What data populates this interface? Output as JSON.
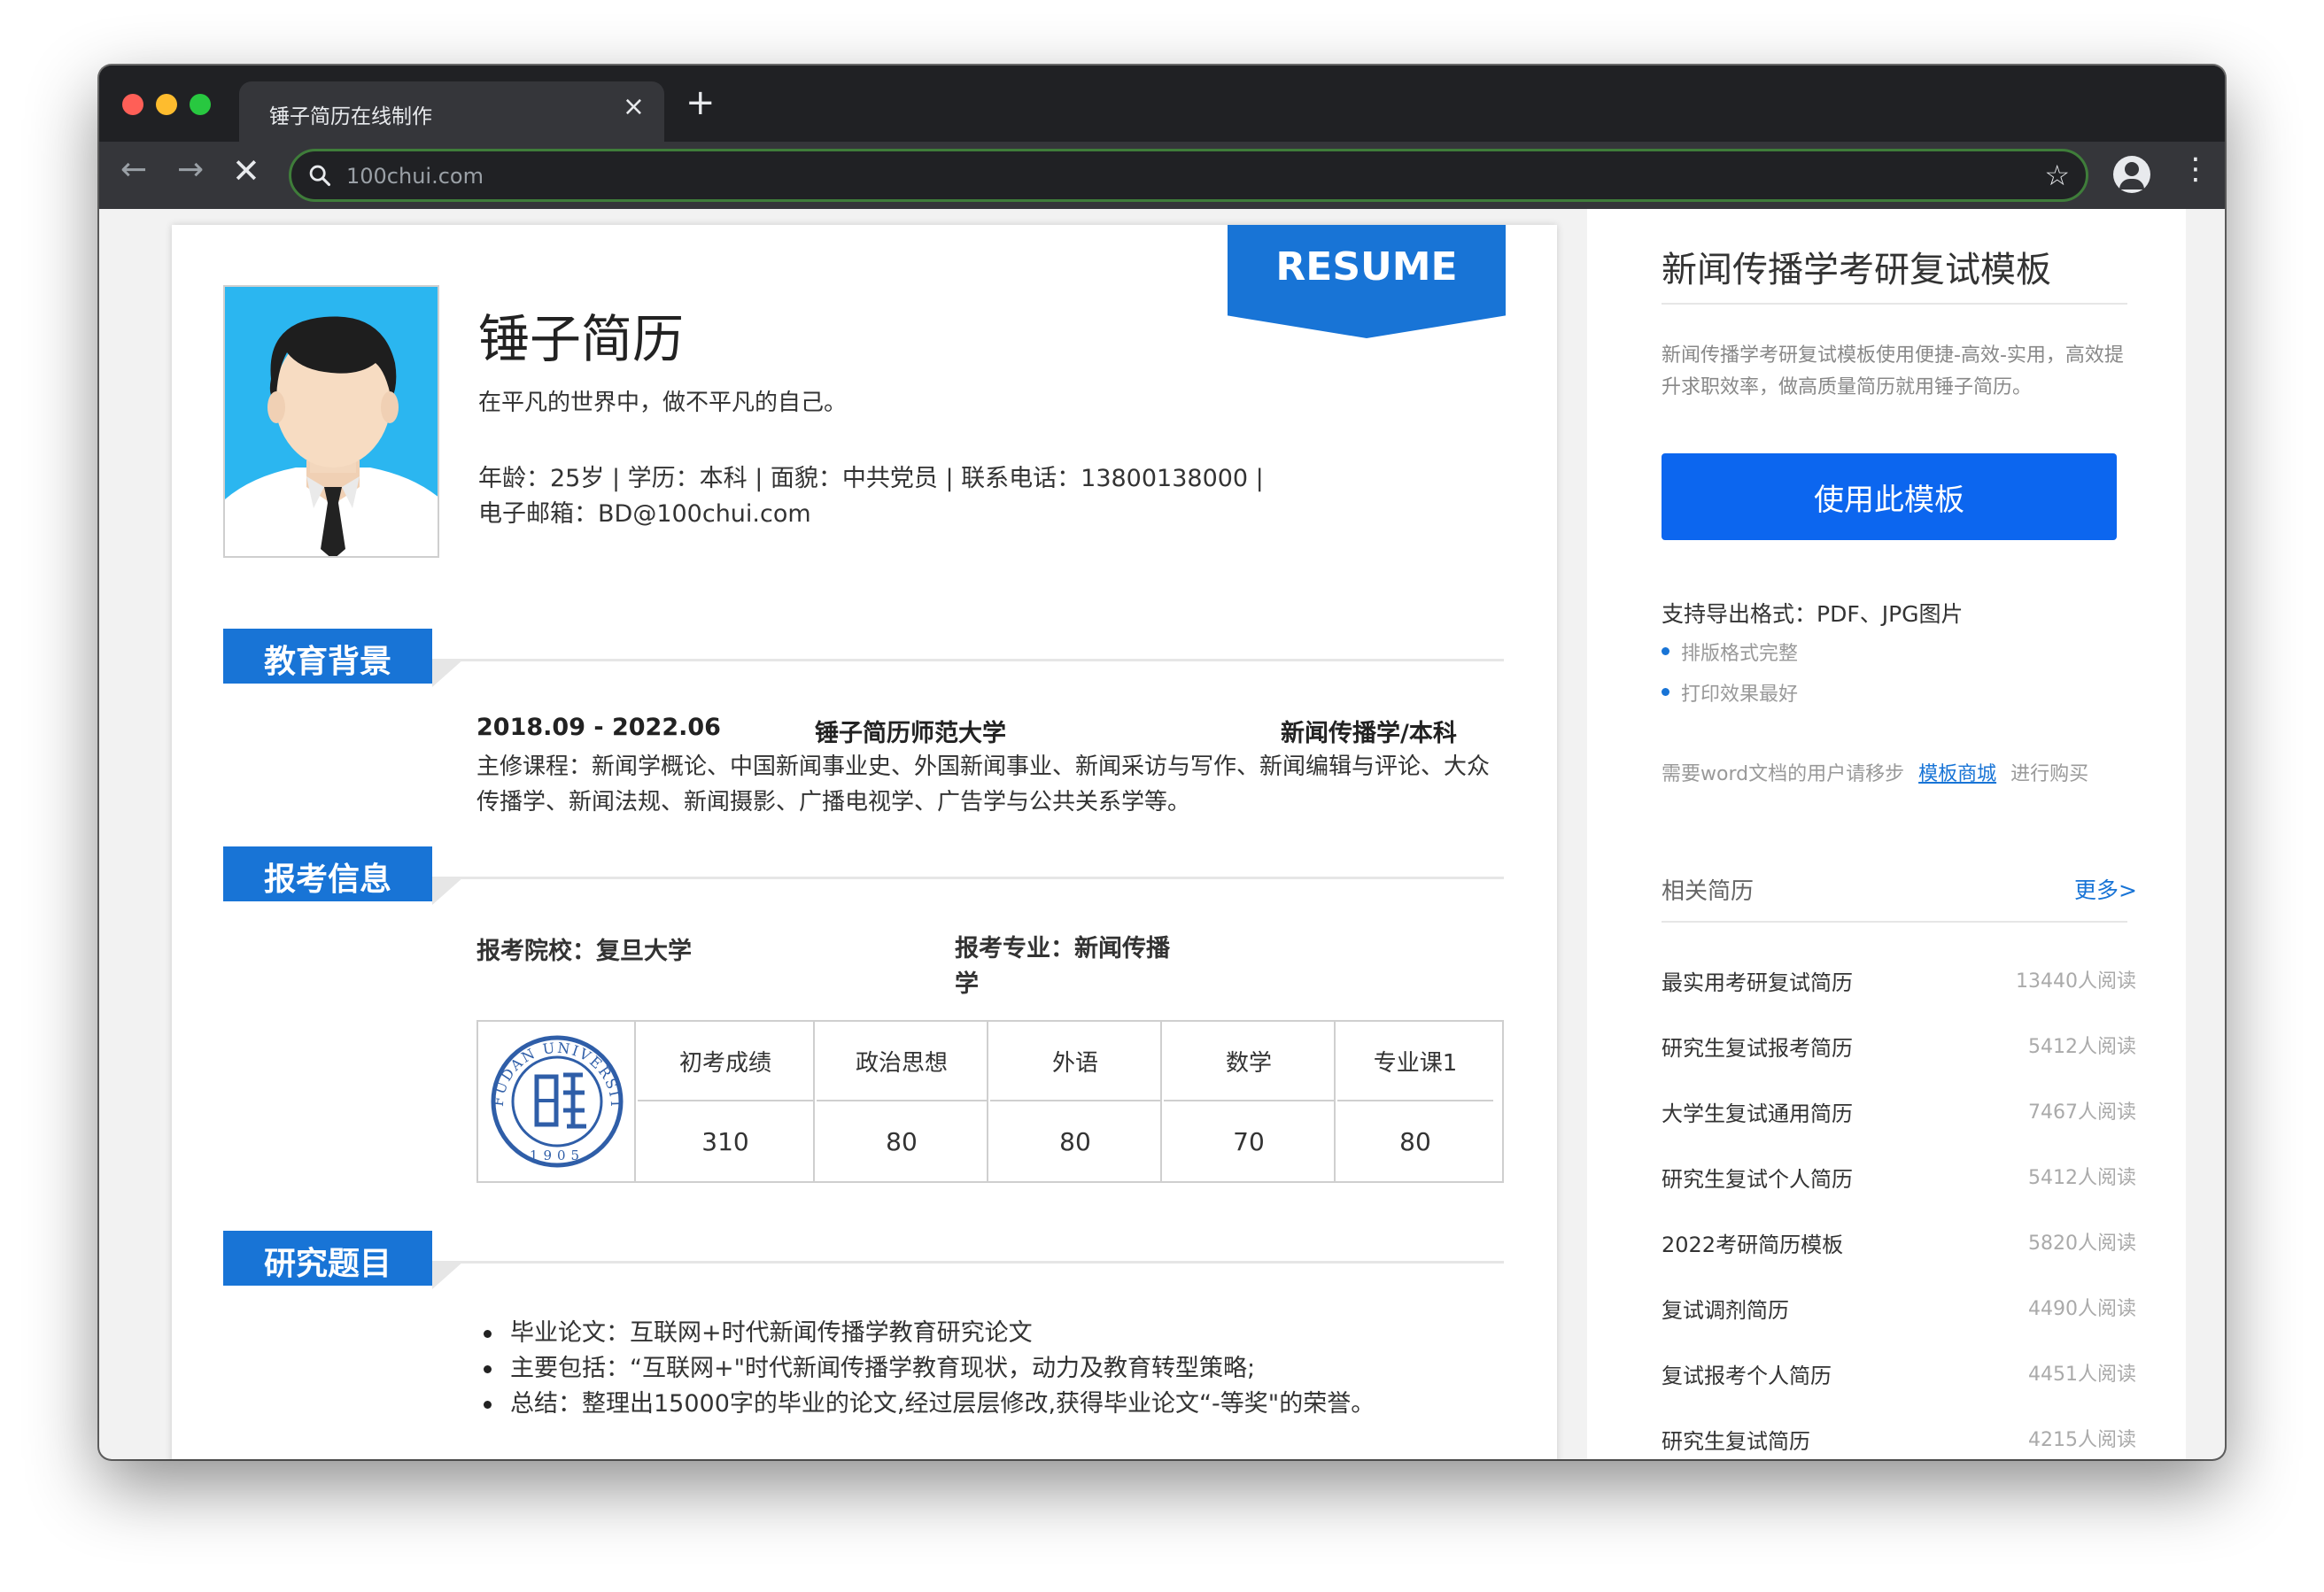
{
  "browser": {
    "tab_title": "锤子简历在线制作",
    "tab_close": "×",
    "new_tab": "+",
    "url": "100chui.com"
  },
  "resume": {
    "ribbon": "RESUME",
    "name": "锤子简历",
    "motto": "在平凡的世界中，做不平凡的自己。",
    "info_line1": "年龄：25岁 | 学历：本科 | 面貌：中共党员 | 联系电话：13800138000 |",
    "info_line2": "电子邮箱：BD@100chui.com",
    "sections": {
      "education": "教育背景",
      "application": "报考信息",
      "research": "研究题目"
    },
    "education": {
      "date": "2018.09 - 2022.06",
      "school": "锤子简历师范大学",
      "major": "新闻传播学/本科",
      "courses": "主修课程：新闻学概论、中国新闻事业史、外国新闻事业、新闻采访与写作、新闻编辑与评论、大众传播学、新闻法规、新闻摄影、广播电视学、广告学与公共关系学等。"
    },
    "application": {
      "school": "报考院校：复旦大学",
      "major": "报考专业：新闻传播学",
      "logo_text": "FUDAN UNIVERSITY",
      "logo_year": "1905",
      "scores": [
        {
          "subject": "初考成绩",
          "value": "310"
        },
        {
          "subject": "政治思想",
          "value": "80"
        },
        {
          "subject": "外语",
          "value": "80"
        },
        {
          "subject": "数学",
          "value": "70"
        },
        {
          "subject": "专业课1",
          "value": "80"
        }
      ]
    },
    "research": [
      "毕业论文：互联网+时代新闻传播学教育研究论文",
      "主要包括：“互联网+\"时代新闻传播学教育现状，动力及教育转型策略;",
      "总结：整理出15000字的毕业的论文,经过层层修改,获得毕业论文“-等奖\"的荣誉。"
    ]
  },
  "sidebar": {
    "title": "新闻传播学考研复试模板",
    "description": "新闻传播学考研复试模板使用便捷-高效-实用，高效提升求职效率，做高质量简历就用锤子简历。",
    "use_button": "使用此模板",
    "formats": "支持导出格式：PDF、JPG图片",
    "features": [
      "排版格式完整",
      "打印效果最好"
    ],
    "word_prefix": "需要word文档的用户请移步",
    "word_link": "模板商城",
    "word_suffix": "进行购买",
    "related_title": "相关简历",
    "more": "更多>",
    "related": [
      {
        "name": "最实用考研复试简历",
        "count": "13440人阅读"
      },
      {
        "name": "研究生复试报考简历",
        "count": "5412人阅读"
      },
      {
        "name": "大学生复试通用简历",
        "count": "7467人阅读"
      },
      {
        "name": "研究生复试个人简历",
        "count": "5412人阅读"
      },
      {
        "name": "2022考研简历模板",
        "count": "5820人阅读"
      },
      {
        "name": "复试调剂简历",
        "count": "4490人阅读"
      },
      {
        "name": "复试报考个人简历",
        "count": "4451人阅读"
      },
      {
        "name": "研究生复试简历",
        "count": "4215人阅读"
      }
    ]
  },
  "colors": {
    "accent_blue": "#1874d6",
    "button_blue": "#0c66ef",
    "photo_bg": "#2bb6f0"
  }
}
